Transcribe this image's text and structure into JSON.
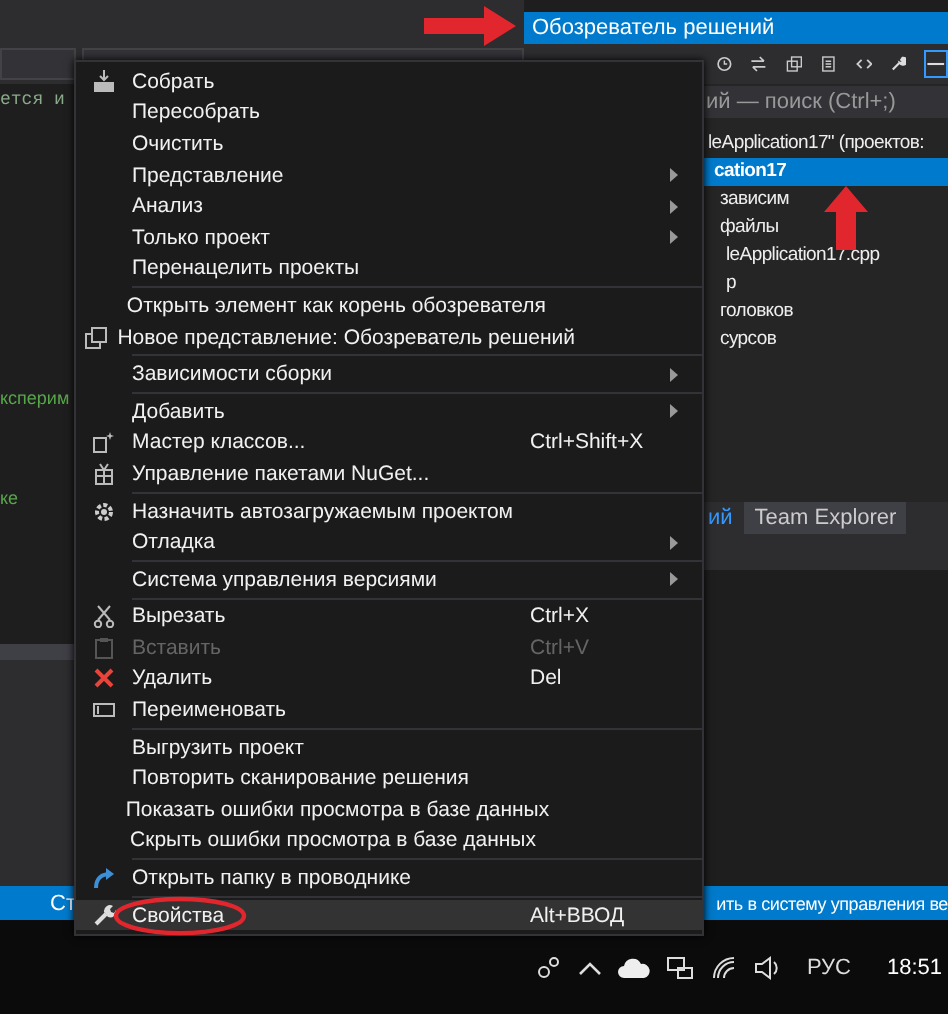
{
  "editor": {
    "code_fragments": [
      "ется и",
      "ксперим",
      "ке"
    ]
  },
  "solution_explorer": {
    "title": "Обозреватель решений",
    "search_placeholder": "ий — поиск (Ctrl+;)",
    "tree": [
      {
        "label": "leApplication17\" (проектов:",
        "selected": false,
        "children": [
          {
            "label": "cation17",
            "selected": true,
            "children": [
              {
                "label": "зависим",
                "selected": false
              },
              {
                "label": "файлы",
                "selected": false,
                "children": [
                  {
                    "label": "leApplication17.cpp",
                    "selected": false
                  },
                  {
                    "label": "p",
                    "selected": false
                  }
                ]
              },
              {
                "label": "головков",
                "selected": false
              },
              {
                "label": "сурсов",
                "selected": false
              }
            ]
          }
        ]
      }
    ],
    "tabs": [
      {
        "label": "ий",
        "selected": true
      },
      {
        "label": "Team Explorer",
        "selected": false
      }
    ]
  },
  "context_menu": {
    "items": [
      {
        "kind": "build",
        "label": "Собрать",
        "submenu": false,
        "disabled": false,
        "selected": false
      },
      {
        "kind": "plain",
        "label": "Пересобрать",
        "submenu": false,
        "disabled": false,
        "selected": false
      },
      {
        "kind": "plain",
        "label": "Очистить",
        "submenu": false,
        "disabled": false,
        "selected": false
      },
      {
        "kind": "plain",
        "label": "Представление",
        "submenu": true,
        "disabled": false,
        "selected": false
      },
      {
        "kind": "plain",
        "label": "Анализ",
        "submenu": true,
        "disabled": false,
        "selected": false
      },
      {
        "kind": "plain",
        "label": "Только проект",
        "submenu": true,
        "disabled": false,
        "selected": false
      },
      {
        "kind": "plain",
        "label": "Перенацелить проекты",
        "submenu": false,
        "disabled": false,
        "selected": false
      },
      {
        "kind": "separator"
      },
      {
        "kind": "plain",
        "label": "Открыть элемент как корень обозревателя",
        "submenu": false,
        "disabled": false,
        "selected": false
      },
      {
        "kind": "windows",
        "label": "Новое представление: Обозреватель решений",
        "submenu": false,
        "disabled": false,
        "selected": false
      },
      {
        "kind": "separator"
      },
      {
        "kind": "plain",
        "label": "Зависимости сборки",
        "submenu": true,
        "disabled": false,
        "selected": false
      },
      {
        "kind": "separator"
      },
      {
        "kind": "plain",
        "label": "Добавить",
        "submenu": true,
        "disabled": false,
        "selected": false
      },
      {
        "kind": "wizard",
        "label": "Мастер классов...",
        "shortcut": "Ctrl+Shift+X",
        "submenu": false,
        "disabled": false,
        "selected": false
      },
      {
        "kind": "package",
        "label": "Управление пакетами NuGet...",
        "submenu": false,
        "disabled": false,
        "selected": false
      },
      {
        "kind": "separator"
      },
      {
        "kind": "gear",
        "label": "Назначить автозагружаемым проектом",
        "submenu": false,
        "disabled": false,
        "selected": false
      },
      {
        "kind": "plain",
        "label": "Отладка",
        "submenu": true,
        "disabled": false,
        "selected": false
      },
      {
        "kind": "separator"
      },
      {
        "kind": "plain",
        "label": "Система управления версиями",
        "submenu": true,
        "disabled": false,
        "selected": false
      },
      {
        "kind": "separator"
      },
      {
        "kind": "scissors",
        "label": "Вырезать",
        "shortcut": "Ctrl+X",
        "submenu": false,
        "disabled": false,
        "selected": false
      },
      {
        "kind": "paste",
        "label": "Вставить",
        "shortcut": "Ctrl+V",
        "submenu": false,
        "disabled": true,
        "selected": false
      },
      {
        "kind": "delete",
        "label": "Удалить",
        "shortcut": "Del",
        "submenu": false,
        "disabled": false,
        "selected": false
      },
      {
        "kind": "rename",
        "label": "Переименовать",
        "submenu": false,
        "disabled": false,
        "selected": false
      },
      {
        "kind": "separator"
      },
      {
        "kind": "plain",
        "label": "Выгрузить проект",
        "submenu": false,
        "disabled": false,
        "selected": false
      },
      {
        "kind": "plain",
        "label": "Повторить сканирование решения",
        "submenu": false,
        "disabled": false,
        "selected": false
      },
      {
        "kind": "plain",
        "label": "Показать ошибки просмотра в базе данных",
        "submenu": false,
        "disabled": false,
        "selected": false
      },
      {
        "kind": "plain",
        "label": "Скрыть ошибки просмотра в базе данных",
        "submenu": false,
        "disabled": false,
        "selected": false
      },
      {
        "kind": "separator"
      },
      {
        "kind": "open",
        "label": "Открыть папку в проводнике",
        "submenu": false,
        "disabled": false,
        "selected": false
      },
      {
        "kind": "separator"
      },
      {
        "kind": "wrench",
        "label": "Свойства",
        "shortcut": "Alt+ВВОД",
        "submenu": false,
        "disabled": false,
        "selected": true,
        "circled": true
      }
    ]
  },
  "status_bar": {
    "left": "Ст",
    "right": "ить в систему управления ве"
  },
  "taskbar": {
    "language": "РУС",
    "time": "18:51"
  }
}
